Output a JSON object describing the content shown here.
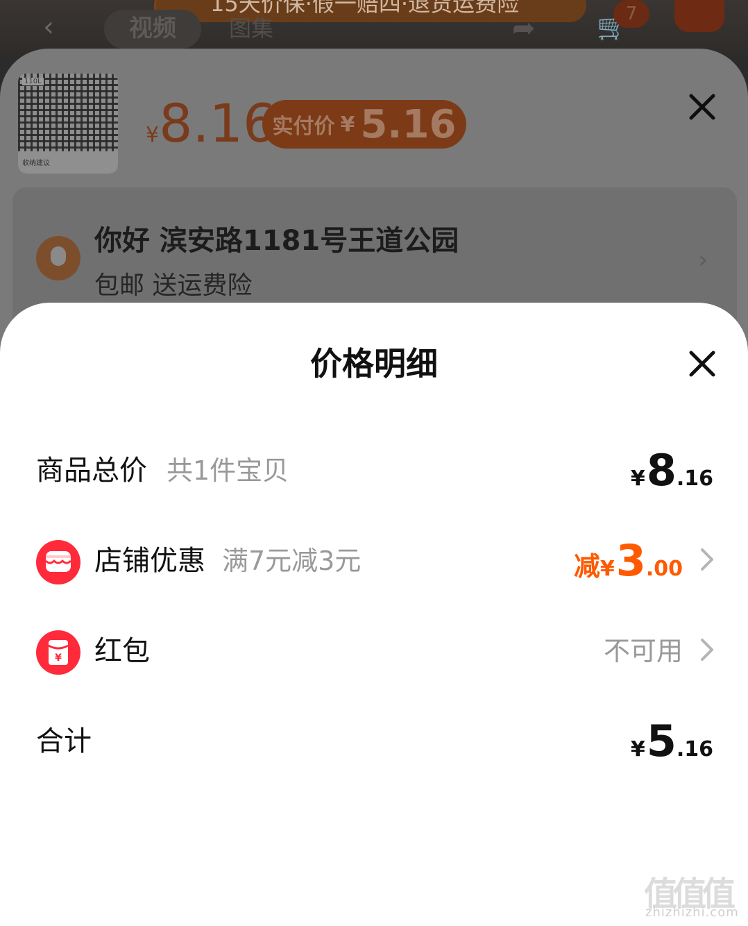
{
  "background": {
    "banner_text": "15天价保·假一赔四·退货运费险",
    "tabs": [
      "视频",
      "图集"
    ],
    "cart_count": "7",
    "product": {
      "thumb_tag": "110L",
      "thumb_caption": "收纳建议",
      "price_currency": "¥",
      "price": "8.16",
      "pay_label": "实付价",
      "pay_currency": "¥",
      "pay_amount": "5.16"
    },
    "address": {
      "line": "你好 滨安路1181号王道公园",
      "sub": "包邮 送运费险"
    }
  },
  "sheet": {
    "title": "价格明细",
    "rows": [
      {
        "label": "商品总价",
        "note": "共1件宝贝",
        "currency": "¥",
        "int": "8",
        "dec": ".16"
      },
      {
        "label": "店铺优惠",
        "note": "满7元减3元",
        "prefix": "减",
        "currency": "¥",
        "int": "3",
        "dec": ".00",
        "icon": "shop-icon"
      },
      {
        "label": "红包",
        "status": "不可用",
        "icon": "red-packet-icon"
      },
      {
        "label": "合计",
        "currency": "¥",
        "int": "5",
        "dec": ".16"
      }
    ]
  },
  "watermark": {
    "text": "zhizhizhi.com"
  },
  "colors": {
    "accent_orange": "#ff5a00",
    "icon_red": "#ff2a3a"
  }
}
